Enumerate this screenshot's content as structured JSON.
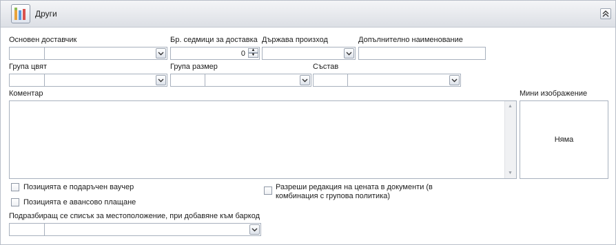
{
  "panel": {
    "title": "Други",
    "collapse_glyph": "⌃",
    "thumbnail_icon": "image-icon"
  },
  "fields": {
    "main_supplier": {
      "label": "Основен доставчик",
      "code": "",
      "value": ""
    },
    "delivery_weeks": {
      "label": "Бр. седмици за доставка",
      "value": "0"
    },
    "country_of_origin": {
      "label": "Държава произход",
      "value": ""
    },
    "additional_name": {
      "label": "Допълнително наименование",
      "value": ""
    },
    "color_group": {
      "label": "Група цвят",
      "code": "",
      "value": ""
    },
    "size_group": {
      "label": "Група размер",
      "code": "",
      "value": ""
    },
    "composition": {
      "label": "Състав",
      "code": "",
      "value": ""
    },
    "comment": {
      "label": "Коментар",
      "value": ""
    },
    "mini_image": {
      "label": "Мини изображение",
      "placeholder": "Няма"
    },
    "gift_voucher": {
      "label": "Позицията е подаръчен ваучер",
      "checked": false
    },
    "advance_payment": {
      "label": "Позицията е авансово плащане",
      "checked": false
    },
    "allow_price_edit": {
      "label_line1": "Разреши редакция на цената в документи (в",
      "label_line2": "комбинация с групова политика)",
      "checked": false
    },
    "default_location": {
      "label": "Подразбиращ се списък за местоположение, при добавяне към баркод",
      "code": "",
      "value": ""
    }
  }
}
